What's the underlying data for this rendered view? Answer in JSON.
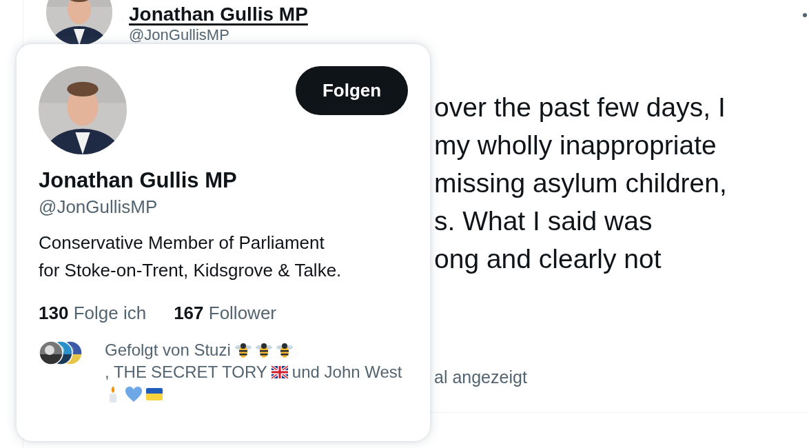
{
  "tweet": {
    "author_name": "Jonathan Gullis MP",
    "author_handle": "@JonGullisMP",
    "text_lines": [
      "over the past few days, I",
      "my wholly inappropriate",
      "missing asylum children,",
      "s. What I said was",
      "ong and clearly not"
    ],
    "translation_note": "al angezeigt"
  },
  "hover_card": {
    "name": "Jonathan Gullis MP",
    "handle": "@JonGullisMP",
    "follow_button": "Folgen",
    "bio": [
      "Conservative Member of Parliament",
      "for Stoke-on-Trent, Kidsgrove & Talke."
    ],
    "stats": [
      {
        "count": "130",
        "label": "Folge ich"
      },
      {
        "count": "167",
        "label": "Follower"
      }
    ],
    "followed_by": [
      {
        "kind": "text",
        "text": "Gefolgt von Stuzi"
      },
      {
        "kind": "bee"
      },
      {
        "kind": "bee"
      },
      {
        "kind": "bee"
      },
      {
        "kind": "text",
        "text": ", THE"
      },
      {
        "kind": "text",
        "text": "SECRET TORY"
      },
      {
        "kind": "uk-flag"
      },
      {
        "kind": "text",
        "text": "und John West"
      },
      {
        "kind": "candle"
      },
      {
        "kind": "heart"
      },
      {
        "kind": "ua-flag"
      }
    ]
  }
}
